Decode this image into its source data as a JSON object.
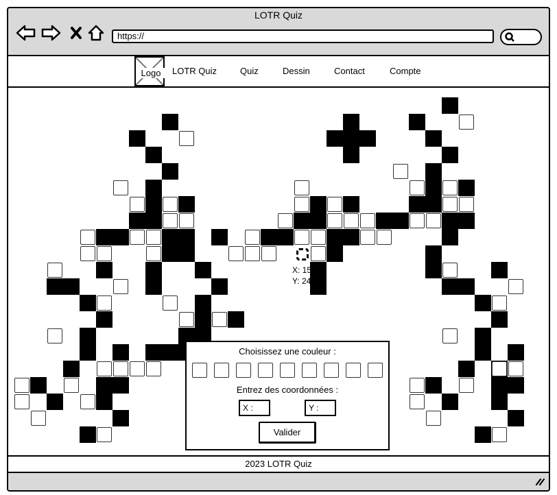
{
  "window": {
    "title": "LOTR Quiz"
  },
  "browser": {
    "url": "https://"
  },
  "nav": {
    "logo": "Logo",
    "links": [
      "LOTR Quiz",
      "Quiz",
      "Dessin",
      "Contact",
      "Compte"
    ]
  },
  "canvas": {
    "cursor": {
      "x_label": "X: 15",
      "y_label": "Y: 24"
    },
    "cells_black": [
      [
        26,
        0
      ],
      [
        9,
        1
      ],
      [
        20,
        1
      ],
      [
        24,
        1
      ],
      [
        7,
        2
      ],
      [
        19,
        2
      ],
      [
        20,
        2
      ],
      [
        21,
        2
      ],
      [
        25,
        2
      ],
      [
        8,
        3
      ],
      [
        20,
        3
      ],
      [
        26,
        3
      ],
      [
        9,
        4
      ],
      [
        25,
        4
      ],
      [
        8,
        5
      ],
      [
        25,
        5
      ],
      [
        27,
        5
      ],
      [
        8,
        6
      ],
      [
        10,
        6
      ],
      [
        18,
        6
      ],
      [
        20,
        6
      ],
      [
        24,
        6
      ],
      [
        25,
        6
      ],
      [
        7,
        7
      ],
      [
        8,
        7
      ],
      [
        17,
        7
      ],
      [
        18,
        7
      ],
      [
        22,
        7
      ],
      [
        23,
        7
      ],
      [
        26,
        7
      ],
      [
        27,
        7
      ],
      [
        5,
        8
      ],
      [
        6,
        8
      ],
      [
        9,
        8
      ],
      [
        10,
        8
      ],
      [
        12,
        8
      ],
      [
        15,
        8
      ],
      [
        16,
        8
      ],
      [
        19,
        8
      ],
      [
        20,
        8
      ],
      [
        26,
        8
      ],
      [
        9,
        9
      ],
      [
        10,
        9
      ],
      [
        19,
        9
      ],
      [
        25,
        9
      ],
      [
        5,
        10
      ],
      [
        8,
        10
      ],
      [
        11,
        10
      ],
      [
        18,
        10
      ],
      [
        25,
        10
      ],
      [
        29,
        10
      ],
      [
        2,
        11
      ],
      [
        3,
        11
      ],
      [
        8,
        11
      ],
      [
        12,
        11
      ],
      [
        18,
        11
      ],
      [
        26,
        11
      ],
      [
        27,
        11
      ],
      [
        4,
        12
      ],
      [
        11,
        12
      ],
      [
        28,
        12
      ],
      [
        5,
        13
      ],
      [
        11,
        13
      ],
      [
        13,
        13
      ],
      [
        29,
        13
      ],
      [
        4,
        14
      ],
      [
        10,
        14
      ],
      [
        11,
        14
      ],
      [
        28,
        14
      ],
      [
        4,
        15
      ],
      [
        6,
        15
      ],
      [
        8,
        15
      ],
      [
        9,
        15
      ],
      [
        10,
        15
      ],
      [
        28,
        15
      ],
      [
        30,
        15
      ],
      [
        3,
        16
      ],
      [
        27,
        16
      ],
      [
        29,
        16
      ],
      [
        1,
        17
      ],
      [
        5,
        17
      ],
      [
        6,
        17
      ],
      [
        25,
        17
      ],
      [
        29,
        17
      ],
      [
        30,
        17
      ],
      [
        2,
        18
      ],
      [
        5,
        18
      ],
      [
        26,
        18
      ],
      [
        29,
        18
      ],
      [
        6,
        19
      ],
      [
        30,
        19
      ],
      [
        4,
        20
      ],
      [
        28,
        20
      ]
    ],
    "cells_white": [
      [
        27,
        1
      ],
      [
        10,
        2
      ],
      [
        23,
        4
      ],
      [
        6,
        5
      ],
      [
        17,
        5
      ],
      [
        24,
        5
      ],
      [
        26,
        5
      ],
      [
        7,
        6
      ],
      [
        9,
        6
      ],
      [
        17,
        6
      ],
      [
        19,
        6
      ],
      [
        26,
        6
      ],
      [
        27,
        6
      ],
      [
        9,
        7
      ],
      [
        10,
        7
      ],
      [
        16,
        7
      ],
      [
        19,
        7
      ],
      [
        20,
        7
      ],
      [
        21,
        7
      ],
      [
        24,
        7
      ],
      [
        25,
        7
      ],
      [
        4,
        8
      ],
      [
        7,
        8
      ],
      [
        8,
        8
      ],
      [
        14,
        8
      ],
      [
        17,
        8
      ],
      [
        18,
        8
      ],
      [
        21,
        8
      ],
      [
        22,
        8
      ],
      [
        4,
        9
      ],
      [
        5,
        9
      ],
      [
        8,
        9
      ],
      [
        13,
        9
      ],
      [
        14,
        9
      ],
      [
        15,
        9
      ],
      [
        18,
        9
      ],
      [
        2,
        10
      ],
      [
        26,
        10
      ],
      [
        6,
        11
      ],
      [
        30,
        11
      ],
      [
        5,
        12
      ],
      [
        9,
        12
      ],
      [
        29,
        12
      ],
      [
        10,
        13
      ],
      [
        12,
        13
      ],
      [
        2,
        14
      ],
      [
        26,
        14
      ],
      [
        5,
        16
      ],
      [
        6,
        16
      ],
      [
        7,
        16
      ],
      [
        8,
        16
      ],
      [
        29,
        16
      ],
      [
        30,
        16
      ],
      [
        0,
        17
      ],
      [
        3,
        17
      ],
      [
        24,
        17
      ],
      [
        27,
        17
      ],
      [
        0,
        18
      ],
      [
        4,
        18
      ],
      [
        24,
        18
      ],
      [
        1,
        19
      ],
      [
        25,
        19
      ],
      [
        5,
        20
      ],
      [
        29,
        20
      ]
    ]
  },
  "panel": {
    "color_label": "Choisissez une couleur :",
    "swatch_count": 9,
    "coords_label": "Entrez des coordonnées :",
    "x_field": "X :",
    "y_field": "Y :",
    "submit_label": "Valider"
  },
  "footer": {
    "text": "2023 LOTR Quiz"
  }
}
